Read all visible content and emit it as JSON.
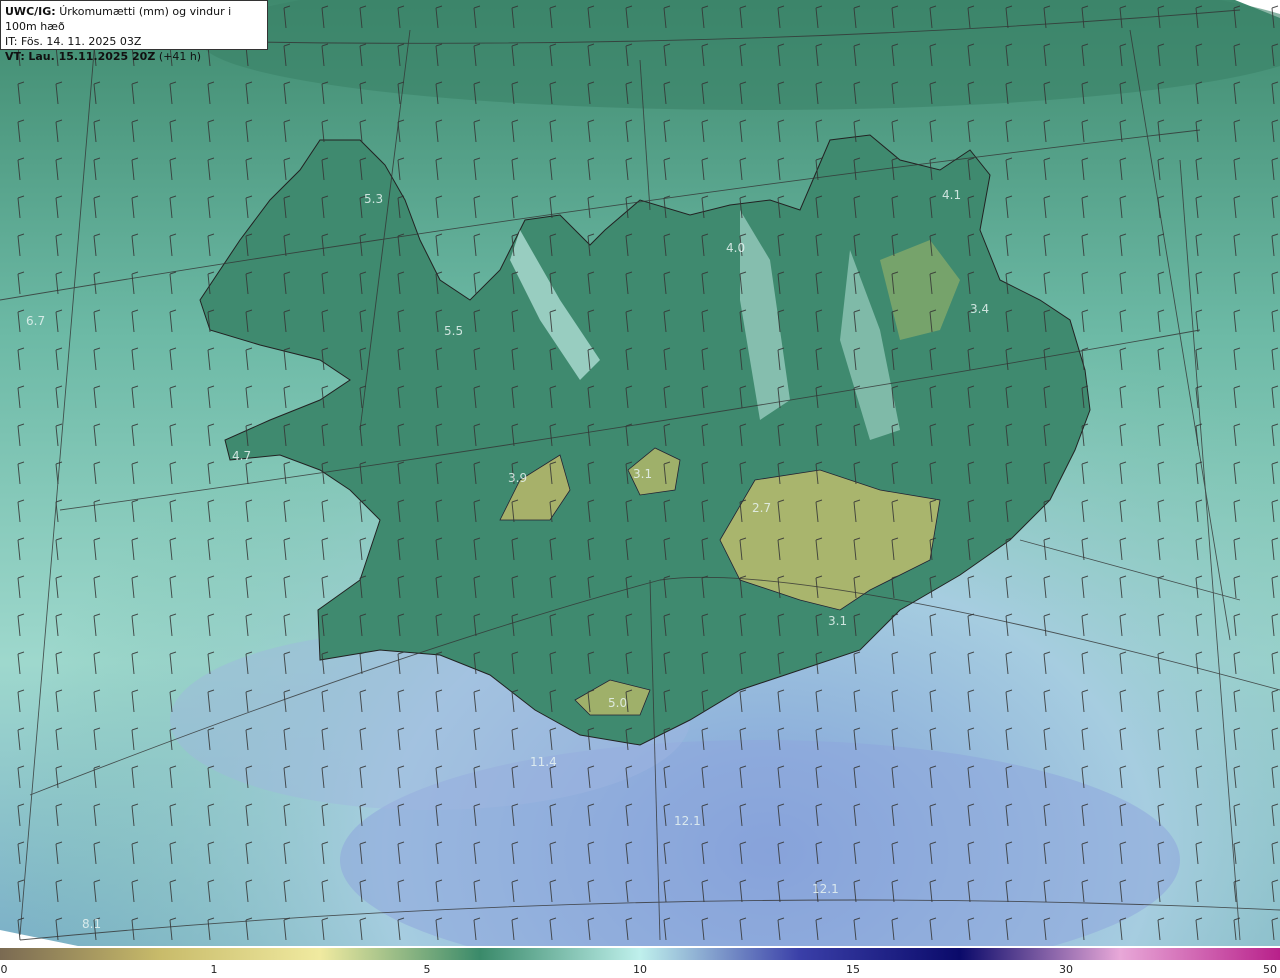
{
  "header": {
    "model": "UWC/IG:",
    "title": "Úrkomumætti (mm) og vindur i 100m hæð",
    "it_label": "IT: Fös. 14. 11. 2025 03Z",
    "vt_prefix": "VT:",
    "vt_value": "Lau. 15.11.2025 20Z",
    "vt_suffix": "(+41 h)"
  },
  "colors": {
    "sea": "#6fb9a8",
    "land": "#3f8a6f",
    "high": "#a9b56d",
    "offshore_blue": "#8fa9d9"
  },
  "colorbar": {
    "ticks": [
      "0",
      "1",
      "5",
      "10",
      "15",
      "30",
      "50"
    ],
    "colors": [
      "#7a6a52",
      "#c8bb6a",
      "#f0eaa0",
      "#3a8a6a",
      "#bff0ec",
      "#3a3fa8",
      "#0a0a6a",
      "#e8a8d8",
      "#b8208a"
    ]
  },
  "values": [
    {
      "text": "5.3"
    },
    {
      "text": "6.7"
    },
    {
      "text": "5.5"
    },
    {
      "text": "4.7"
    },
    {
      "text": "3.9"
    },
    {
      "text": "3.1"
    },
    {
      "text": "4.0"
    },
    {
      "text": "4.1"
    },
    {
      "text": "3.4"
    },
    {
      "text": "2.7"
    },
    {
      "text": "3.1"
    },
    {
      "text": "5.0"
    },
    {
      "text": "11.4"
    },
    {
      "text": "12.1"
    },
    {
      "text": "12.1"
    },
    {
      "text": "8.1"
    }
  ]
}
